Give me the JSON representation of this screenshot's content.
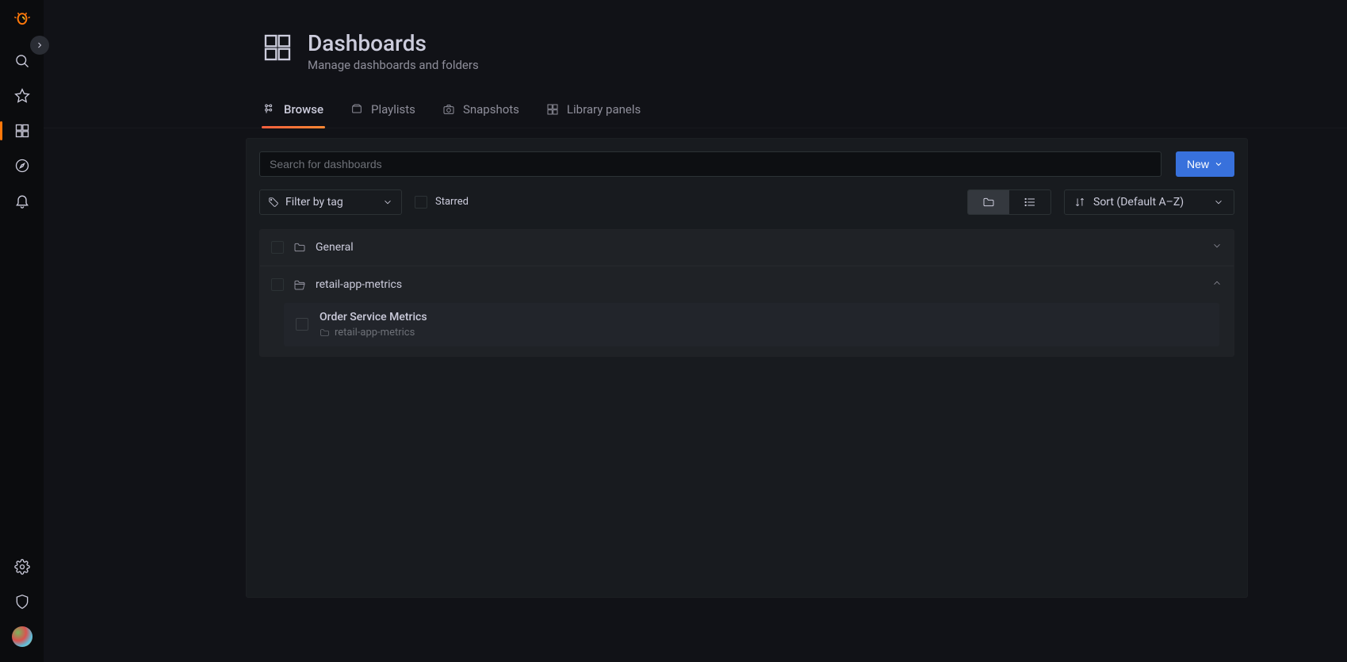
{
  "page": {
    "title": "Dashboards",
    "subtitle": "Manage dashboards and folders"
  },
  "tabs": [
    {
      "label": "Browse"
    },
    {
      "label": "Playlists"
    },
    {
      "label": "Snapshots"
    },
    {
      "label": "Library panels"
    }
  ],
  "toolbar": {
    "search_placeholder": "Search for dashboards",
    "new_label": "New",
    "filter_tag_label": "Filter by tag",
    "starred_label": "Starred",
    "sort_label": "Sort (Default A–Z)"
  },
  "folders": [
    {
      "name": "General",
      "expanded": false
    },
    {
      "name": "retail-app-metrics",
      "expanded": true,
      "dashboards": [
        {
          "title": "Order Service Metrics",
          "folder": "retail-app-metrics"
        }
      ]
    }
  ]
}
